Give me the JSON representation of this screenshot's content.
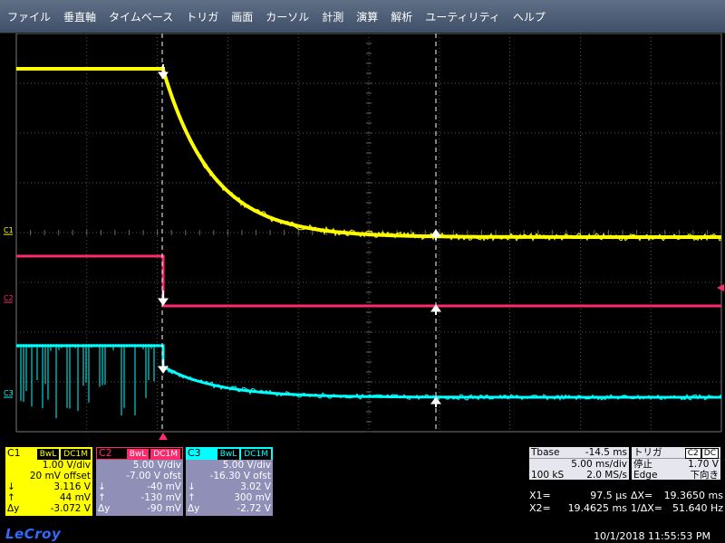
{
  "menu": [
    "ファイル",
    "垂直軸",
    "タイムベース",
    "トリガ",
    "画面",
    "カーソル",
    "計測",
    "演算",
    "解析",
    "ユーティリティ",
    "ヘルプ"
  ],
  "channels": {
    "c1": {
      "name": "C1",
      "tags": [
        "BwL",
        "DC1M"
      ],
      "color": "#ffff00",
      "vdiv": "1.00 V/div",
      "offset": "20 mV offset",
      "cur1": "3.116 V",
      "cur2": "44 mV",
      "delta": "-3.072 V",
      "marker": "C1"
    },
    "c2": {
      "name": "C2",
      "tags": [
        "BwL",
        "DC1M"
      ],
      "color": "#ff2a6d",
      "vdiv": "5.00 V/div",
      "offset": "-7.00 V ofst",
      "cur1": "-40 mV",
      "cur2": "-130 mV",
      "delta": "-90 mV",
      "marker": "C2"
    },
    "c3": {
      "name": "C3",
      "tags": [
        "BwL",
        "DC1M"
      ],
      "color": "#00ffff",
      "vdiv": "5.00 V/div",
      "offset": "-16.30 V ofst",
      "cur1": "3.02 V",
      "cur2": "300 mV",
      "delta": "-2.72 V",
      "marker": "C3"
    }
  },
  "symbols": {
    "down": "↓",
    "up": "↑",
    "delta_y": "Δy"
  },
  "timebase": {
    "label": "Tbase",
    "delay": "-14.5 ms",
    "tdiv": "5.00 ms/div",
    "samples": "100 kS",
    "rate": "2.0 MS/s"
  },
  "trigger": {
    "label": "トリガ",
    "source": "C2",
    "coupling": "DC",
    "mode": "停止",
    "level": "1.70 V",
    "type": "Edge",
    "slope": "下向き"
  },
  "cursors": {
    "x1_label": "X1=",
    "x1": "97.5 µs",
    "dx_label": "ΔX=",
    "dx": "19.3650 ms",
    "x2_label": "X2=",
    "x2": "19.4625 ms",
    "inv_label": "1/ΔX=",
    "inv": "51.640 Hz"
  },
  "brand": "LeCroy",
  "datetime": "10/1/2018 11:55:53 PM"
}
